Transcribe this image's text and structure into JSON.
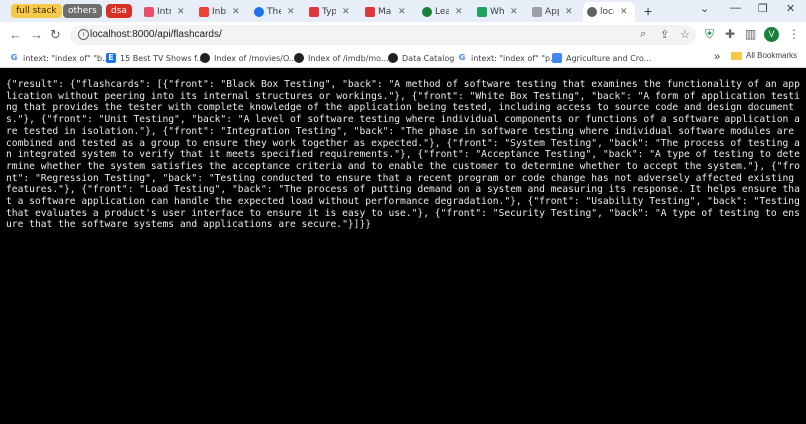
{
  "tab_groups": [
    {
      "label": "full stack",
      "color": "#f6c94a"
    },
    {
      "label": "others",
      "color": "#6e6e6e"
    },
    {
      "label": "dsa",
      "color": "#d93025"
    }
  ],
  "tabs": [
    {
      "title": "Intr",
      "icon": "s-icon",
      "color": "#e94f6b"
    },
    {
      "title": "Inb",
      "icon": "gmail-icon",
      "color": "#ea4335"
    },
    {
      "title": "The",
      "icon": "thumbtack-icon",
      "color": "#1a73e8"
    },
    {
      "title": "Typ",
      "icon": "gwent-icon",
      "color": "#e0373a"
    },
    {
      "title": "Mai",
      "icon": "gwent-icon",
      "color": "#e0373a"
    },
    {
      "title": "Lea",
      "icon": "leaf-icon",
      "color": "#188038"
    },
    {
      "title": "Wh",
      "icon": "k-icon",
      "color": "#1ea362"
    },
    {
      "title": "App",
      "icon": "puzzle-icon",
      "color": "#9aa0a6"
    },
    {
      "title": "loca",
      "icon": "globe-icon",
      "color": "#5f6368",
      "active": true
    }
  ],
  "toolbar": {
    "url": "localhost:8000/api/flashcards/",
    "profile_initial": "V"
  },
  "bookmarks": [
    {
      "label": "intext: \"index of\" \"b...",
      "icon": "google-icon"
    },
    {
      "label": "15 Best TV Shows f...",
      "icon": "ie-icon"
    },
    {
      "label": "Index of /movies/O...",
      "icon": "globe-icon"
    },
    {
      "label": "Index of /imdb/mo...",
      "icon": "globe-icon"
    },
    {
      "label": "Data Catalog",
      "icon": "globe-icon"
    },
    {
      "label": "intext: \"index of\" \"p...",
      "icon": "google-icon"
    },
    {
      "label": "Agriculture and Cro...",
      "icon": "doc-icon"
    }
  ],
  "bookmarks_overflow": "»",
  "all_bookmarks": "All Bookmarks",
  "response_text": "{\"result\": {\"flashcards\": [{\"front\": \"Black Box Testing\", \"back\": \"A method of software testing that examines the functionality of an application without peering into its internal structures or workings.\"}, {\"front\": \"White Box Testing\", \"back\": \"A form of application testing that provides the tester with complete knowledge of the application being tested, including access to source code and design documents.\"}, {\"front\": \"Unit Testing\", \"back\": \"A level of software testing where individual components or functions of a software application are tested in isolation.\"}, {\"front\": \"Integration Testing\", \"back\": \"The phase in software testing where individual software modules are combined and tested as a group to ensure they work together as expected.\"}, {\"front\": \"System Testing\", \"back\": \"The process of testing an integrated system to verify that it meets specified requirements.\"}, {\"front\": \"Acceptance Testing\", \"back\": \"A type of testing to determine whether the system satisfies the acceptance criteria and to enable the customer to determine whether to accept the system.\"}, {\"front\": \"Regression Testing\", \"back\": \"Testing conducted to ensure that a recent program or code change has not adversely affected existing features.\"}, {\"front\": \"Load Testing\", \"back\": \"The process of putting demand on a system and measuring its response. It helps ensure that a software application can handle the expected load without performance degradation.\"}, {\"front\": \"Usability Testing\", \"back\": \"Testing that evaluates a product's user interface to ensure it is easy to use.\"}, {\"front\": \"Security Testing\", \"back\": \"A type of testing to ensure that the software systems and applications are secure.\"}]}}"
}
